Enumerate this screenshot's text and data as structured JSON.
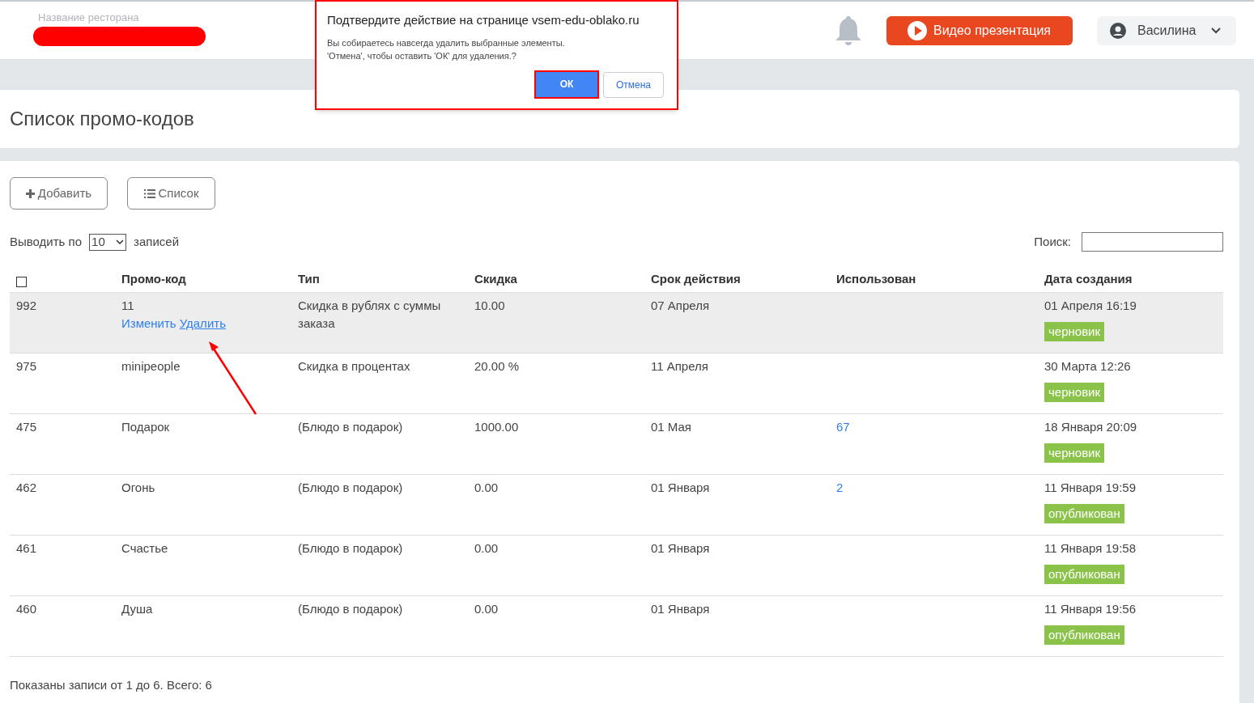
{
  "header": {
    "restaurant_label": "Название ресторана",
    "video_button": "Видео презентация",
    "user": "Василина"
  },
  "dialog": {
    "title": "Подтвердите действие на странице vsem-edu-oblako.ru",
    "message": [
      "Вы собираетесь навсегда удалить выбранные элементы.",
      "'Отмена', чтобы оставить 'ОК' для удаления.?"
    ],
    "ok": "ОК",
    "cancel": "Отмена"
  },
  "page_title": "Список промо-кодов",
  "toolbar": {
    "add": "Добавить",
    "list": "Список"
  },
  "length": {
    "before": "Выводить по",
    "value": "10",
    "after": "записей"
  },
  "search": {
    "label": "Поиск:"
  },
  "table": {
    "select_all": false,
    "columns": [
      "Промо-код",
      "Тип",
      "Скидка",
      "Срок действия",
      "Использован",
      "Дата создания"
    ],
    "rows": [
      {
        "id": "992",
        "code": "11",
        "actions": [
          "Изменить",
          "Удалить"
        ],
        "type": "Скидка в рублях с суммы заказа",
        "discount": "10.00",
        "expiry": "07 Апреля",
        "used": "",
        "created": "01 Апреля 16:19",
        "status": "черновик",
        "highlighted": true
      },
      {
        "id": "975",
        "code": "minipeople",
        "type": "Скидка в процентах",
        "discount": "20.00 %",
        "expiry": "11 Апреля",
        "used": "",
        "created": "30 Марта 12:26",
        "status": "черновик",
        "highlighted": false
      },
      {
        "id": "475",
        "code": "Подарок",
        "type": "(Блюдо в подарок)",
        "discount": "1000.00",
        "expiry": "01 Мая",
        "used": "67",
        "created": "18 Января 20:09",
        "status": "черновик",
        "highlighted": false
      },
      {
        "id": "462",
        "code": "Огонь",
        "type": "(Блюдо в подарок)",
        "discount": "0.00",
        "expiry": "01 Января",
        "used": "2",
        "created": "11 Января 19:59",
        "status": "опубликован",
        "highlighted": false
      },
      {
        "id": "461",
        "code": "Счастье",
        "type": "(Блюдо в подарок)",
        "discount": "0.00",
        "expiry": "01 Января",
        "used": "",
        "created": "11 Января 19:58",
        "status": "опубликован",
        "highlighted": false
      },
      {
        "id": "460",
        "code": "Душа",
        "type": "(Блюдо в подарок)",
        "discount": "0.00",
        "expiry": "01 Января",
        "used": "",
        "created": "11 Января 19:56",
        "status": "опубликован",
        "highlighted": false
      }
    ]
  },
  "footer": "Показаны записи от 1 до 6. Всего: 6"
}
